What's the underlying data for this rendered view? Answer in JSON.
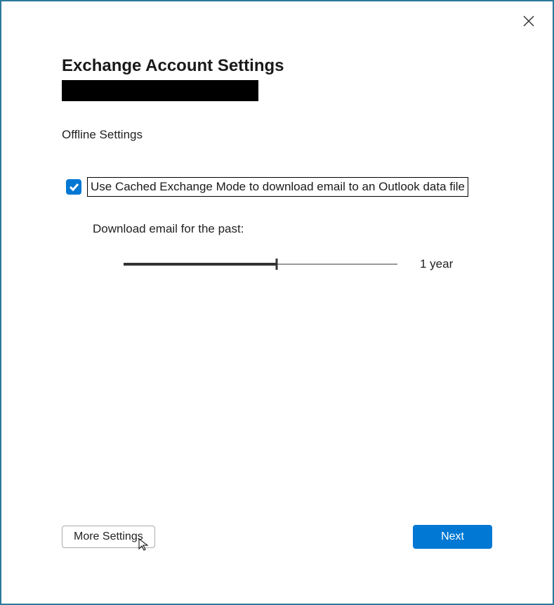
{
  "title": "Exchange Account Settings",
  "section_label": "Offline Settings",
  "checkbox": {
    "checked": true,
    "label": "Use Cached Exchange Mode to download email to an Outlook data file"
  },
  "download_label": "Download email for the past:",
  "slider": {
    "value_label": "1 year",
    "position_percent": 56
  },
  "buttons": {
    "more_settings": "More Settings",
    "next": "Next"
  }
}
